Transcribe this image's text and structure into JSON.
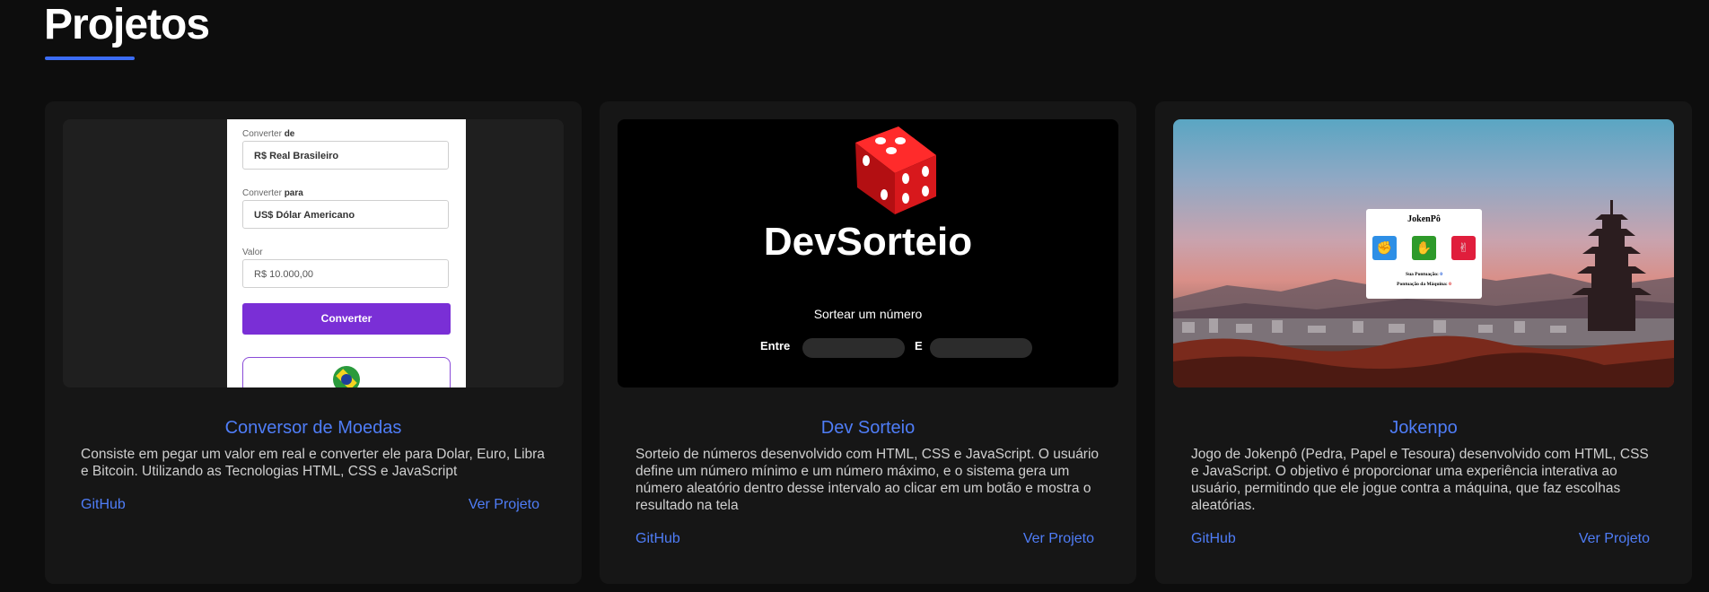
{
  "section": {
    "title": "Projetos"
  },
  "projects": [
    {
      "title": "Conversor de Moedas",
      "description": "Consiste em pegar um valor em real e converter ele para Dolar, Euro, Libra e Bitcoin. Utilizando as Tecnologias HTML, CSS e JavaScript",
      "github_label": "GitHub",
      "view_label": "Ver Projeto",
      "preview": {
        "from_label_prefix": "Converter ",
        "from_label_strong": "de",
        "from_value": "R$ Real Brasileiro",
        "to_label_prefix": "Converter ",
        "to_label_strong": "para",
        "to_value": "US$ Dólar Americano",
        "amount_label": "Valor",
        "amount_value": "R$ 10.000,00",
        "button_label": "Converter"
      }
    },
    {
      "title": "Dev Sorteio",
      "description": "Sorteio de números desenvolvido com HTML, CSS e JavaScript. O usuário define um número mínimo e um número máximo, e o sistema gera um número aleatório dentro desse intervalo ao clicar em um botão e mostra o resultado na tela",
      "github_label": "GitHub",
      "view_label": "Ver Projeto",
      "preview": {
        "brand": "DevSorteio",
        "subtitle": "Sortear um número",
        "between_label": "Entre",
        "and_label": "E"
      }
    },
    {
      "title": "Jokenpo",
      "description": "Jogo de Jokenpô (Pedra, Papel e Tesoura) desenvolvido com HTML, CSS e JavaScript. O objetivo é proporcionar uma experiência interativa ao usuário, permitindo que ele jogue contra a máquina, que faz escolhas aleatórias.",
      "github_label": "GitHub",
      "view_label": "Ver Projeto",
      "preview": {
        "game_title": "JokenPô",
        "your_score_label": "Sua Pontuação:",
        "your_score": "0",
        "machine_score_label": "Pontuação da Máquina:",
        "machine_score": "0"
      }
    }
  ],
  "colors": {
    "accent": "#4f7df7",
    "underline": "#3b6cf5",
    "card_bg": "#161616",
    "page_bg": "#0d0d0d",
    "convert_button": "#7a2fd6"
  }
}
